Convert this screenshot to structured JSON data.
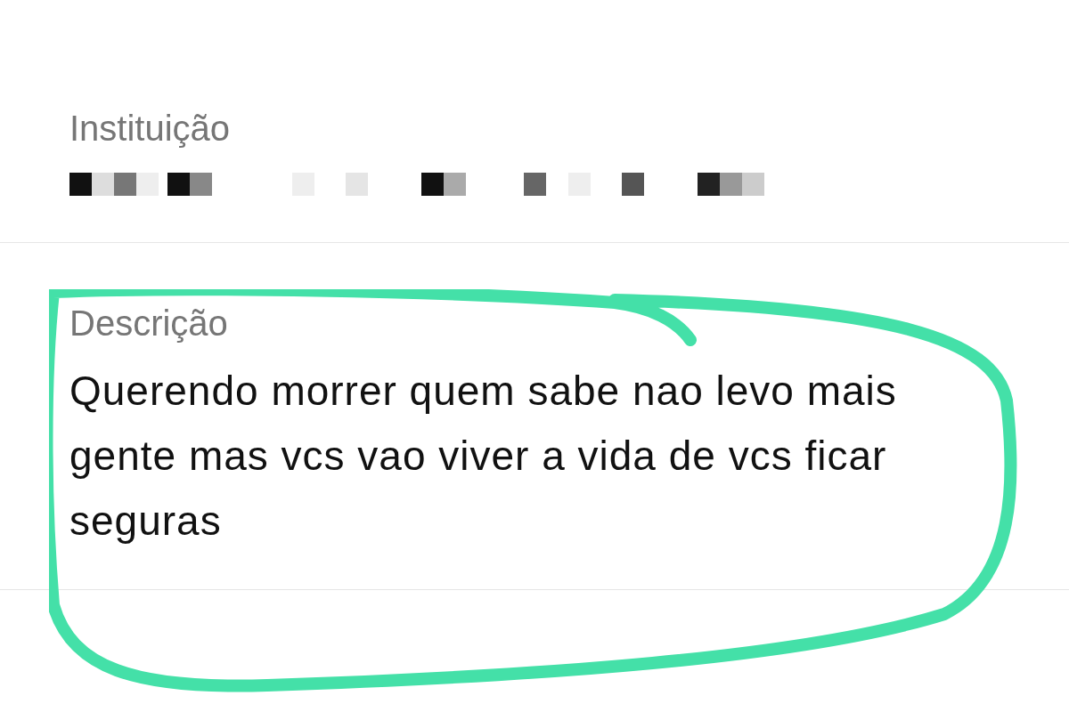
{
  "fields": [
    {
      "label": "Instituição",
      "kind": "redacted"
    },
    {
      "label": "Descrição",
      "kind": "text",
      "value": "Querendo morrer quem sabe nao levo mais gente mas vcs vao viver a vida de vcs ficar seguras"
    }
  ]
}
